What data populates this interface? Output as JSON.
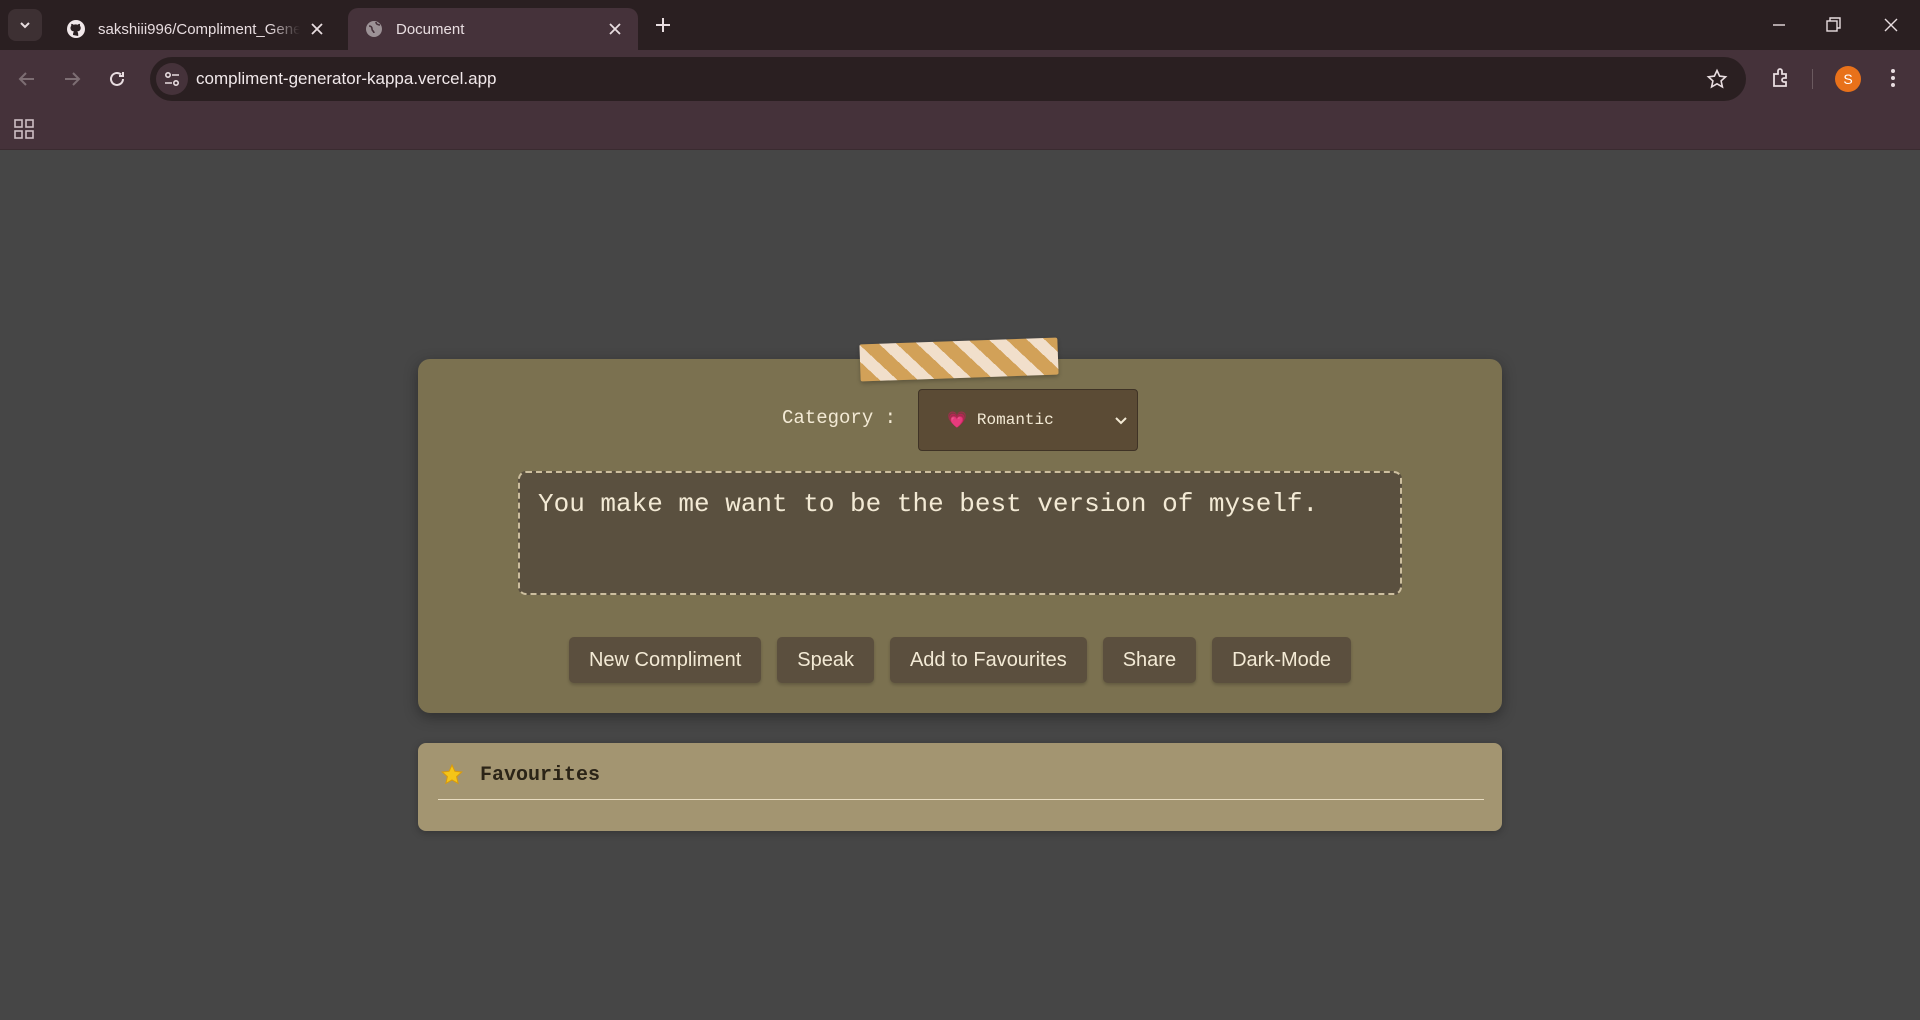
{
  "browser": {
    "tabs": [
      {
        "title": "sakshiii996/Compliment_Generator",
        "favicon": "github-icon",
        "active": false
      },
      {
        "title": "Document",
        "favicon": "globe-icon",
        "active": true
      }
    ],
    "url": "compliment-generator-kappa.vercel.app",
    "profile_initial": "S"
  },
  "app": {
    "category_label": "Category :",
    "category_selected": "Romantic",
    "category_emoji": "💗",
    "compliment": "You make me want to be the best version of myself.",
    "buttons": {
      "new": "New Compliment",
      "speak": "Speak",
      "add_fav": "Add to Favourites",
      "share": "Share",
      "dark_mode": "Dark-Mode"
    },
    "favourites": {
      "emoji": "⭐",
      "title": "Favourites",
      "items": []
    }
  },
  "colors": {
    "card": "#7b7150",
    "favourites_card": "#a39571",
    "page_bg": "#464646",
    "tape_stripe_a": "#d2a158",
    "tape_stripe_b": "#f1dfcb"
  }
}
